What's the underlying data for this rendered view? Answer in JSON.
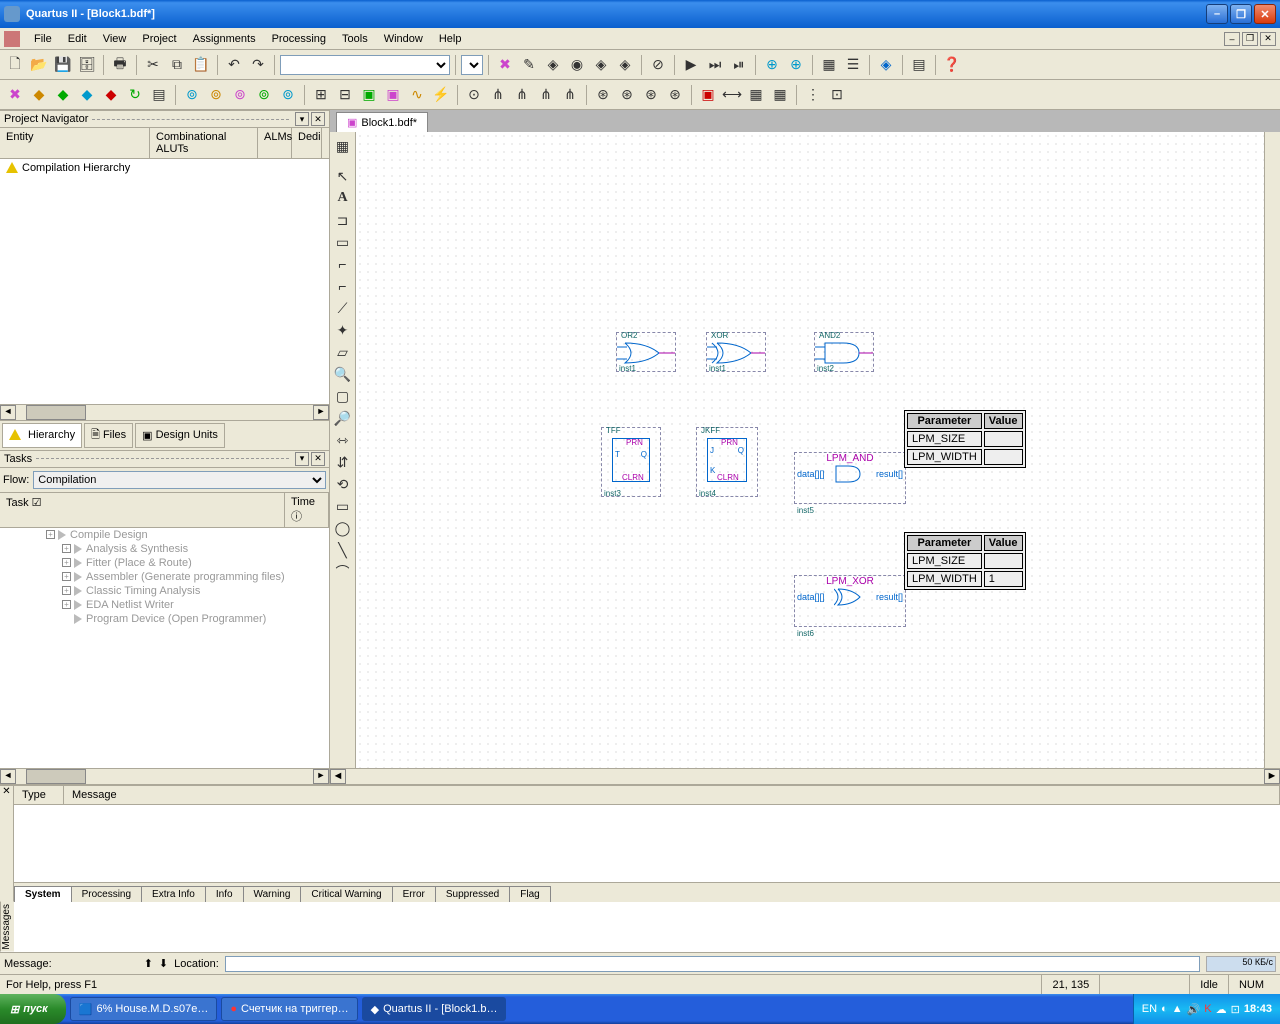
{
  "window": {
    "title": "Quartus II - [Block1.bdf*]"
  },
  "menu": {
    "file": "File",
    "edit": "Edit",
    "view": "View",
    "project": "Project",
    "assignments": "Assignments",
    "processing": "Processing",
    "tools": "Tools",
    "window": "Window",
    "help": "Help"
  },
  "projectNavigator": {
    "title": "Project Navigator",
    "cols": {
      "entity": "Entity",
      "aluts": "Combinational ALUTs",
      "alms": "ALMs",
      "dedi": "Dedi"
    },
    "row": "Compilation Hierarchy",
    "tabs": {
      "hierarchy": "Hierarchy",
      "files": "Files",
      "designUnits": "Design Units"
    }
  },
  "tasks": {
    "title": "Tasks",
    "flowLabel": "Flow:",
    "flowValue": "Compilation",
    "cols": {
      "task": "Task ☑",
      "time": "Time ⓘ"
    },
    "items": [
      {
        "indent": 1,
        "label": "Compile Design"
      },
      {
        "indent": 2,
        "label": "Analysis & Synthesis"
      },
      {
        "indent": 2,
        "label": "Fitter (Place & Route)"
      },
      {
        "indent": 2,
        "label": "Assembler (Generate programming files)"
      },
      {
        "indent": 2,
        "label": "Classic Timing Analysis"
      },
      {
        "indent": 2,
        "label": "EDA Netlist Writer"
      },
      {
        "indent": 2,
        "label": "Program Device (Open Programmer)"
      }
    ]
  },
  "doc": {
    "tab": "Block1.bdf*"
  },
  "gates": {
    "or2": {
      "type": "OR2",
      "inst": "inst1"
    },
    "xor": {
      "type": "XOR",
      "inst": "inst1"
    },
    "and2": {
      "type": "AND2",
      "inst": "inst2"
    },
    "tff": {
      "type": "TFF",
      "inst": "inst3",
      "prn": "PRN",
      "clrn": "CLRN",
      "t": "T",
      "q": "Q"
    },
    "jkff": {
      "type": "JKFF",
      "inst": "inst4",
      "prn": "PRN",
      "clrn": "CLRN",
      "j": "J",
      "k": "K",
      "q": "Q"
    },
    "lpmand": {
      "title": "LPM_AND",
      "data": "data[][]",
      "result": "result[]",
      "inst": "inst5"
    },
    "lpmxor": {
      "title": "LPM_XOR",
      "data": "data[][]",
      "result": "result[]",
      "inst": "inst6"
    }
  },
  "paramTable1": {
    "h1": "Parameter",
    "h2": "Value",
    "r1": "LPM_SIZE",
    "r2": "LPM_WIDTH",
    "v1": "",
    "v2": ""
  },
  "paramTable2": {
    "h1": "Parameter",
    "h2": "Value",
    "r1": "LPM_SIZE",
    "r2": "LPM_WIDTH",
    "v1": "",
    "v2": "1"
  },
  "messages": {
    "sideLabel": "Messages",
    "cols": {
      "type": "Type",
      "message": "Message"
    },
    "tabs": [
      "System",
      "Processing",
      "Extra Info",
      "Info",
      "Warning",
      "Critical Warning",
      "Error",
      "Suppressed",
      "Flag"
    ],
    "footer": {
      "message": "Message:",
      "location": "Location:"
    }
  },
  "statusbar": {
    "help": "For Help, press F1",
    "coords": "21, 135",
    "idle": "Idle",
    "num": "NUM"
  },
  "taskbar": {
    "start": "пуск",
    "items": [
      "6% House.M.D.s07e…",
      "Счетчик на триггер…",
      "Quartus II - [Block1.b…"
    ],
    "lang": "EN",
    "clock": "18:43",
    "net": "50 КБ/с"
  }
}
